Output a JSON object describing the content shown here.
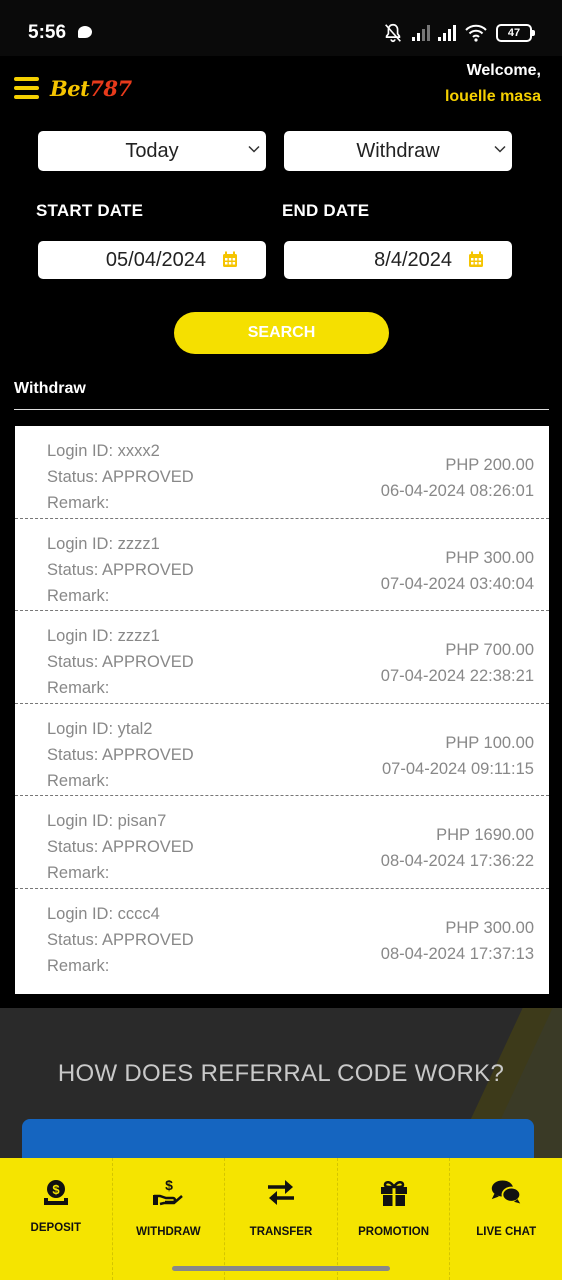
{
  "status_bar": {
    "time": "5:56",
    "battery": "47"
  },
  "header": {
    "logo_main": "Bet",
    "logo_num": "787",
    "welcome": "Welcome,",
    "username": "louelle masa"
  },
  "filters": {
    "period": "Today",
    "type": "Withdraw",
    "start_label": "START DATE",
    "end_label": "END DATE",
    "start_date": "05/04/2024",
    "end_date": "8/4/2024",
    "search_label": "SEARCH"
  },
  "section_title": "Withdraw",
  "records": [
    {
      "login": "Login ID: xxxx2",
      "status": "Status: APPROVED",
      "remark": "Remark:",
      "amount": "PHP 200.00",
      "datetime": "06-04-2024 08:26:01"
    },
    {
      "login": "Login ID: zzzz1",
      "status": "Status: APPROVED",
      "remark": "Remark:",
      "amount": "PHP 300.00",
      "datetime": "07-04-2024 03:40:04"
    },
    {
      "login": "Login ID: zzzz1",
      "status": "Status: APPROVED",
      "remark": "Remark:",
      "amount": "PHP 700.00",
      "datetime": "07-04-2024 22:38:21"
    },
    {
      "login": "Login ID: ytal2",
      "status": "Status: APPROVED",
      "remark": "Remark:",
      "amount": "PHP 100.00",
      "datetime": "07-04-2024 09:11:15"
    },
    {
      "login": "Login ID: pisan7",
      "status": "Status: APPROVED",
      "remark": "Remark:",
      "amount": "PHP 1690.00",
      "datetime": "08-04-2024 17:36:22"
    },
    {
      "login": "Login ID: cccc4",
      "status": "Status: APPROVED",
      "remark": "Remark:",
      "amount": "PHP 300.00",
      "datetime": "08-04-2024 17:37:13"
    }
  ],
  "referral_heading": "HOW DOES REFERRAL CODE WORK?",
  "bottom_nav": [
    {
      "label": "DEPOSIT",
      "icon": "deposit-icon"
    },
    {
      "label": "WITHDRAW",
      "icon": "withdraw-icon"
    },
    {
      "label": "TRANSFER",
      "icon": "transfer-icon"
    },
    {
      "label": "PROMOTION",
      "icon": "gift-icon"
    },
    {
      "label": "LIVE CHAT",
      "icon": "chat-icon"
    }
  ],
  "colors": {
    "accent": "#f5e400",
    "brand_yellow": "#f5d000",
    "background": "#000000",
    "card_blue": "#1565c0"
  }
}
